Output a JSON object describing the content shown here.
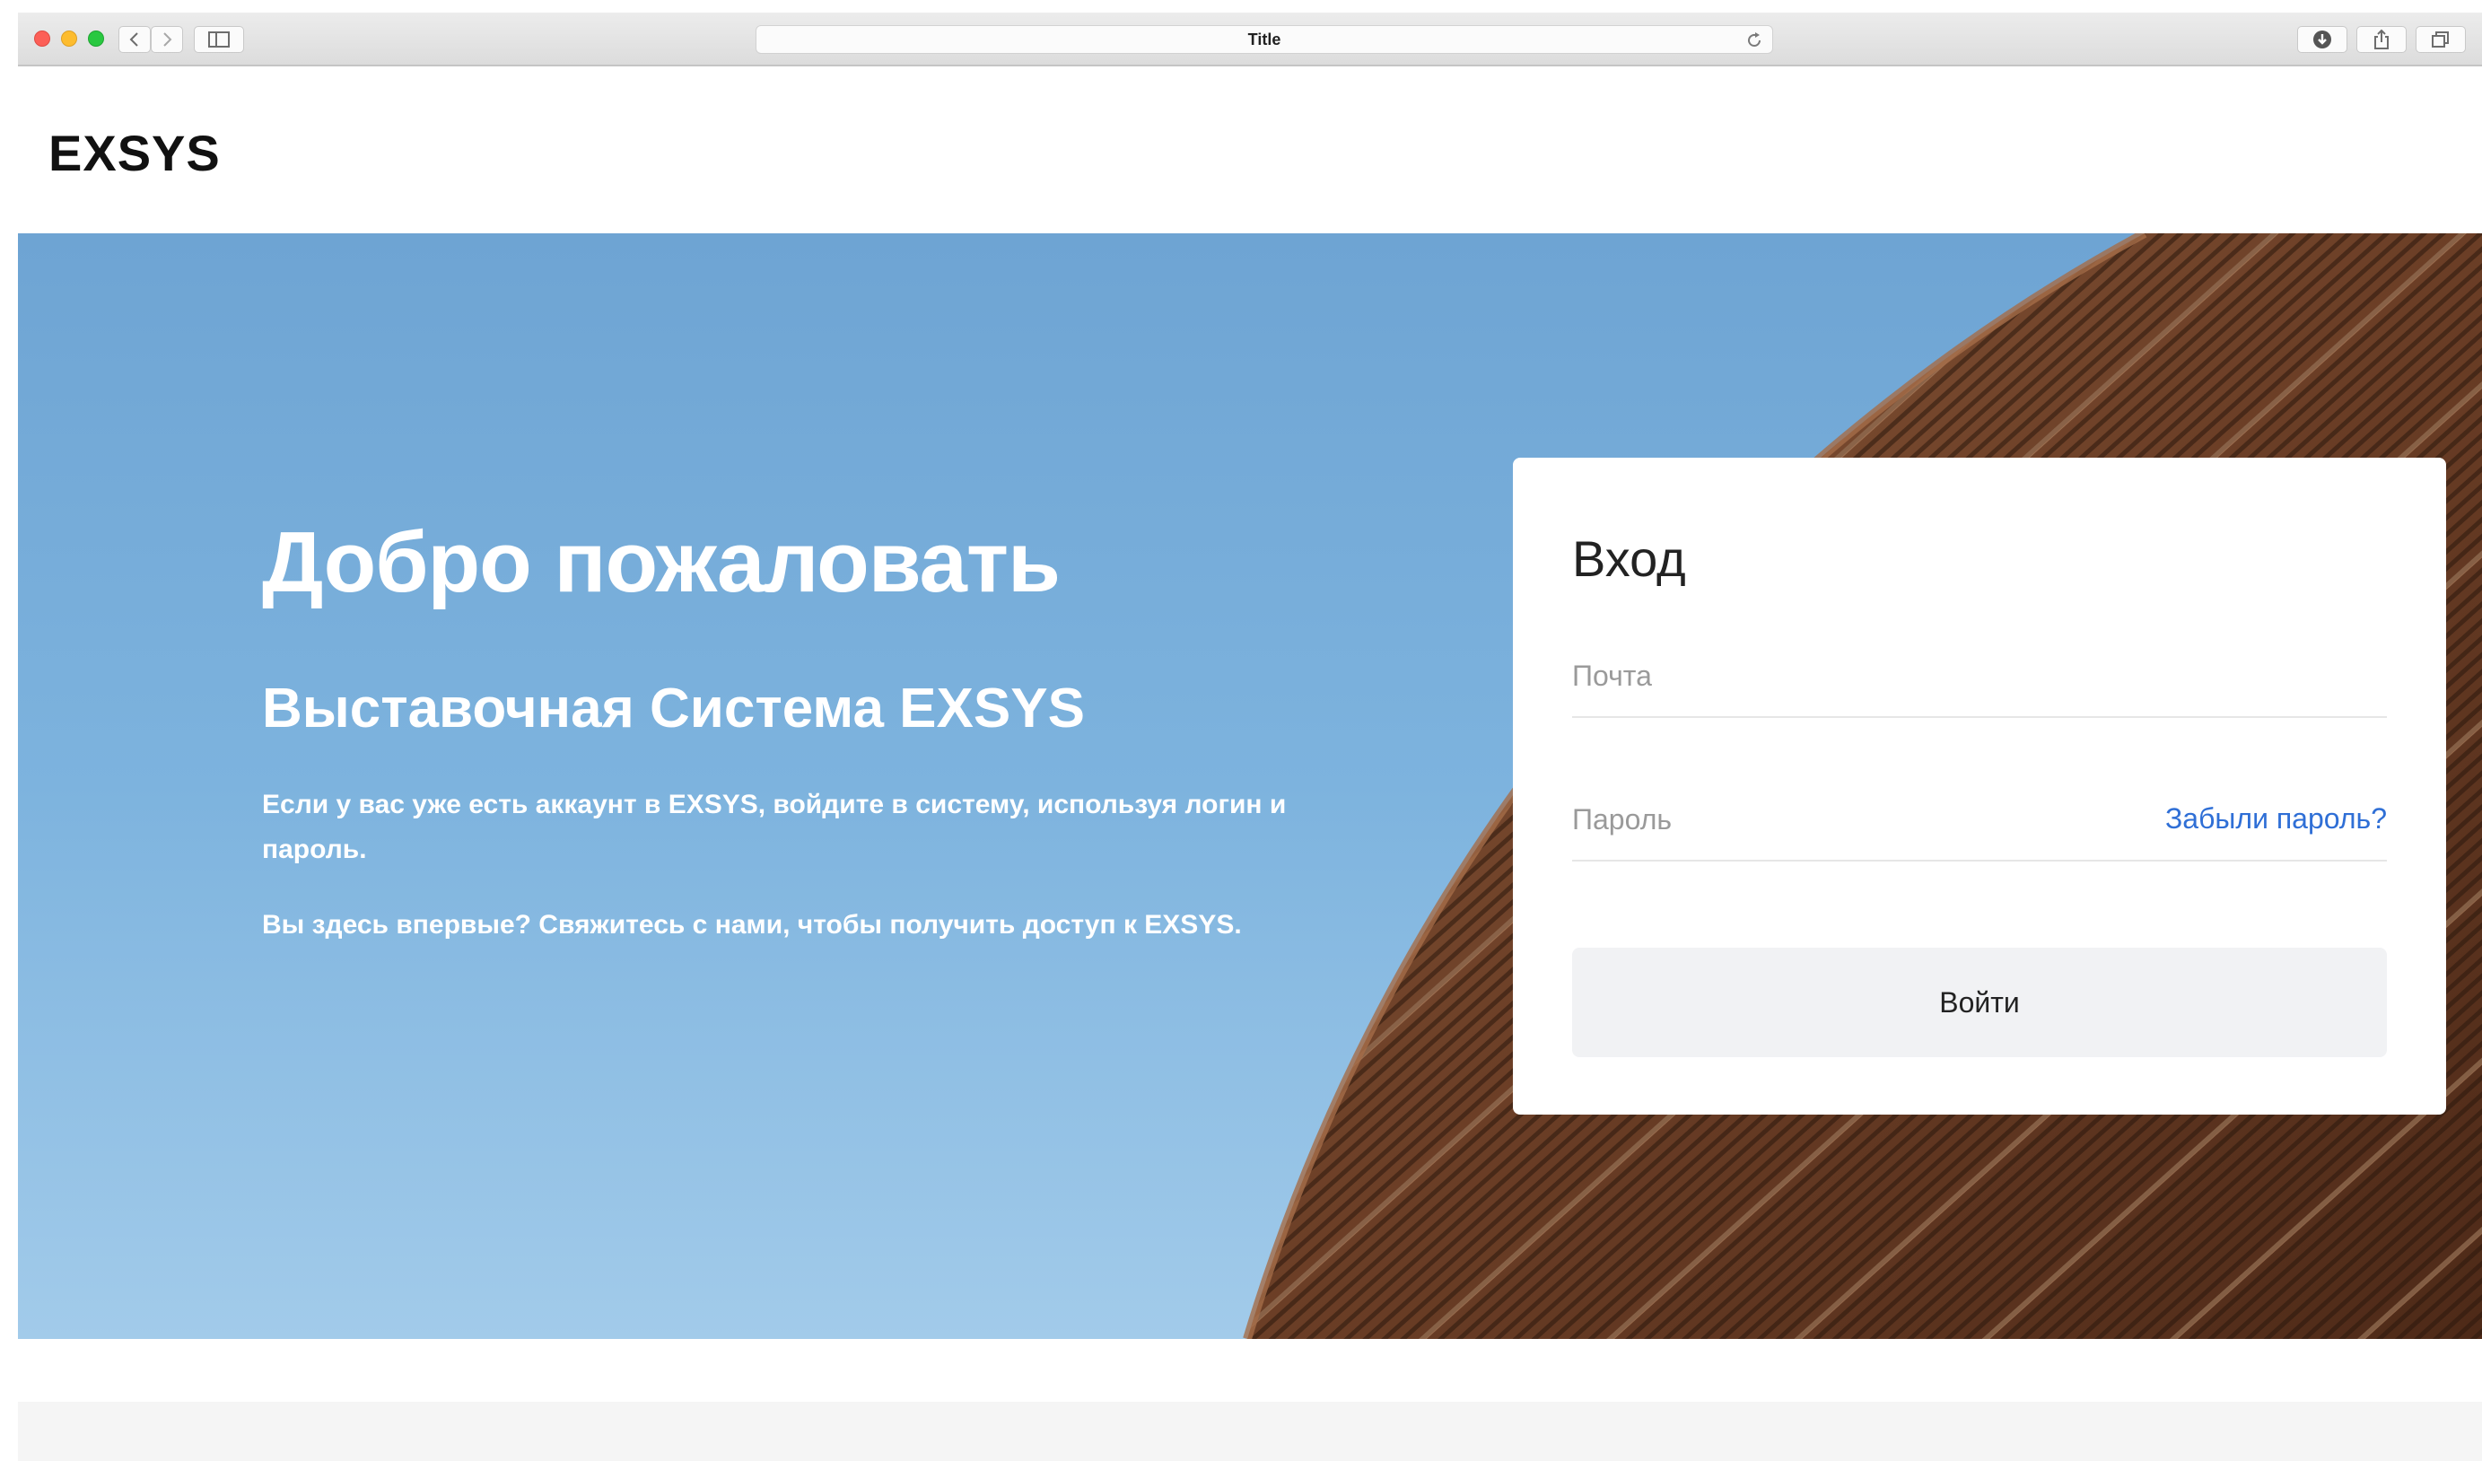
{
  "browser": {
    "tab_title": "Title"
  },
  "header": {
    "logo": "EXSYS"
  },
  "hero": {
    "title": "Добро пожаловать",
    "subtitle": "Выставочная Система EXSYS",
    "paragraph_1": "Если у вас уже есть аккаунт в EXSYS, войдите в систему, используя логин и пароль.",
    "paragraph_2": "Вы здесь впервые? Свяжитесь с нами, чтобы получить доступ к EXSYS."
  },
  "login": {
    "title": "Вход",
    "email_placeholder": "Почта",
    "password_placeholder": "Пароль",
    "forgot_link": "Забыли пароль?",
    "submit_label": "Войти"
  },
  "colors": {
    "sky": "#7fb4df",
    "building": "#6b3e26",
    "link": "#2f6fd6",
    "button_bg": "#f1f2f4"
  }
}
